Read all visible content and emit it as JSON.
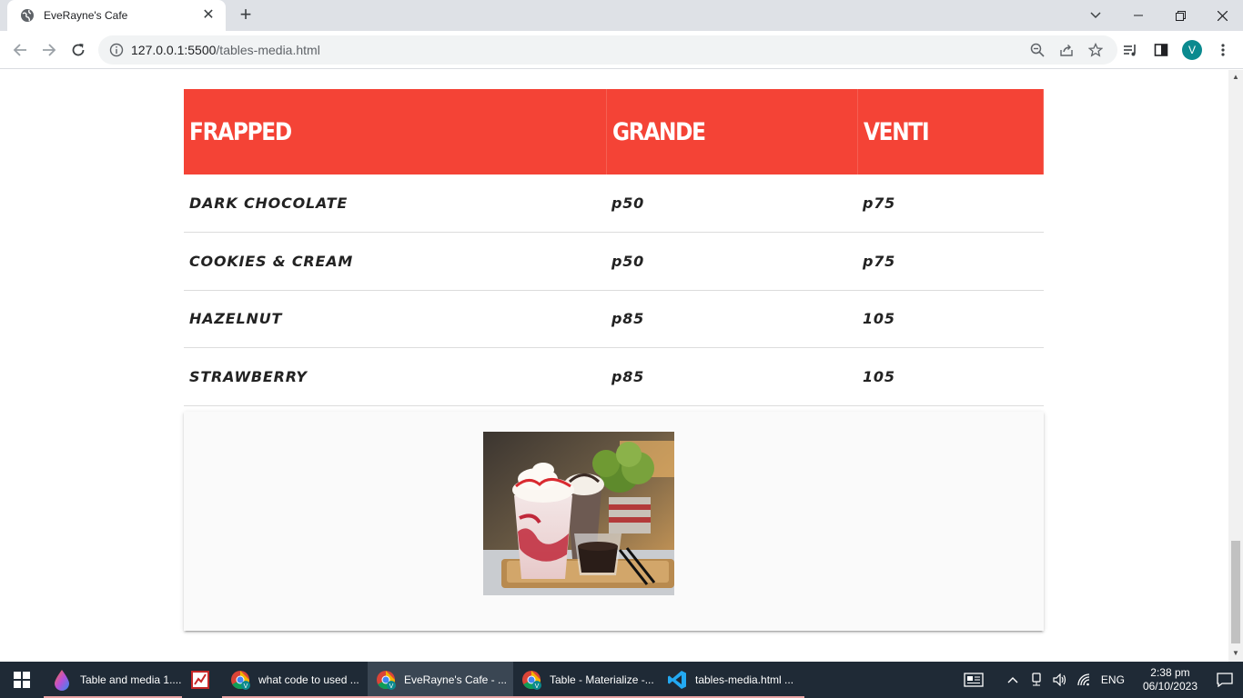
{
  "browser": {
    "tab_title": "EveRayne's Cafe",
    "url_host": "127.0.0.1:5500",
    "url_path": "/tables-media.html",
    "profile_initial": "V"
  },
  "table": {
    "headers": [
      "FRAPPED",
      "GRANDE",
      "VENTI"
    ],
    "rows": [
      [
        "DARK CHOCOLATE",
        "p50",
        "p75"
      ],
      [
        "COOKIES & CREAM",
        "p50",
        "p75"
      ],
      [
        "HAZELNUT",
        "p85",
        "105"
      ],
      [
        "STRAWBERRY",
        "p85",
        "105"
      ]
    ]
  },
  "colors": {
    "header_bg": "#f44336",
    "taskbar_bg": "#1f2a36",
    "profile_bg": "#0b8a8f"
  },
  "taskbar": {
    "items": [
      {
        "label": "Table and media 1....",
        "icon": "paint-drop-icon"
      },
      {
        "label": "",
        "icon": "chart-app-icon"
      },
      {
        "label": "what code to used ...",
        "icon": "chrome-icon"
      },
      {
        "label": "EveRayne's Cafe - ...",
        "icon": "chrome-icon"
      },
      {
        "label": "Table - Materialize -...",
        "icon": "chrome-icon"
      },
      {
        "label": "tables-media.html ...",
        "icon": "vscode-icon"
      }
    ],
    "language": "ENG",
    "time": "2:38 pm",
    "date": "06/10/2023"
  }
}
